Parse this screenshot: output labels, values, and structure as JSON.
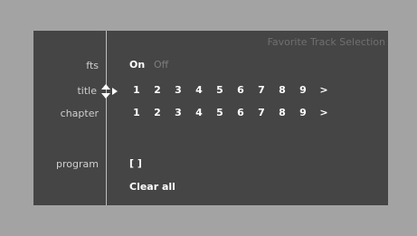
{
  "screen": {
    "title": "Favorite Track Selection",
    "background_color": "#a3a3a3",
    "panel_color": "#454545"
  },
  "fts": {
    "label": "fts",
    "on_label": "On",
    "off_label": "Off",
    "selected": "On"
  },
  "title_row": {
    "label": "title",
    "items": [
      "1",
      "2",
      "3",
      "4",
      "5",
      "6",
      "7",
      "8",
      "9",
      ">"
    ]
  },
  "chapter_row": {
    "label": "chapter",
    "items": [
      "1",
      "2",
      "3",
      "4",
      "5",
      "6",
      "7",
      "8",
      "9",
      ">"
    ]
  },
  "program": {
    "label": "program",
    "value": "[ ]"
  },
  "actions": {
    "clear_all": "Clear all"
  },
  "icons": {
    "selector": "up-down-arrow-icon",
    "pointer": "right-arrow-icon"
  }
}
